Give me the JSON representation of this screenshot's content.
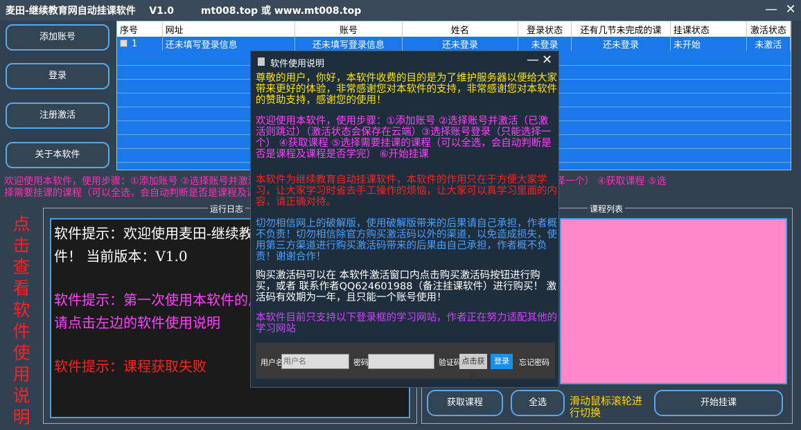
{
  "window": {
    "title": "麦田-继续教育网自动挂课软件    V1.0        mt008.top 或 www.mt008.top",
    "minimize_glyph": "—",
    "close_glyph": "✕"
  },
  "sidebar": {
    "add_account": "添加账号",
    "login": "登录",
    "register": "注册激活",
    "about": "关于本软件"
  },
  "table": {
    "headers": [
      "序号",
      "网址",
      "账号",
      "姓名",
      "登录状态",
      "还有几节未完成的课",
      "挂课状态",
      "激活状态"
    ],
    "rows": [
      [
        "1",
        "还未填写登录信息",
        "还未填写登录信息",
        "还未登录",
        "未登录",
        "还未登录",
        "未开始",
        "未激活"
      ]
    ]
  },
  "usage": {
    "line1": "欢迎使用本软件，使用步骤：①添加账号    ②选择账号并激活（已激活则跳过）（激活状态会保存在云端）  ③选择账号登录（只能选择一个）  ④获取课程  ⑤选",
    "line2": "择需要挂课的课程（可以全选，会自动判断是否是课程及课程是否学完）  ⑥开始挂课"
  },
  "log": {
    "title": "运行日志",
    "lines": [
      {
        "text": "软件提示：欢迎使用麦田-继续教育网自动挂课软",
        "color": "#ffffff"
      },
      {
        "text": "件！  当前版本：V1.0",
        "color": "#ffffff"
      },
      {
        "text": "软件提示：第一次使用本软件的用户",
        "color": "#ff40ff"
      },
      {
        "text": "请点击左边的软件使用说明",
        "color": "#ff40ff"
      },
      {
        "text": "软件提示：课程获取失败",
        "color": "#ff2020"
      }
    ]
  },
  "side_hint": "点击查看软件使用说明",
  "course": {
    "title": "课程列表",
    "fetch_button": "获取课程",
    "select_all_button": "全选",
    "scroll_tip": "滑动鼠标滚轮进行切换",
    "start_button": "开始挂课"
  },
  "dialog": {
    "title": "软件使用说明",
    "minimize_glyph": "—",
    "close_glyph": "✕",
    "paragraphs": [
      {
        "text": "尊敬的用户，你好，本软件收费的目的是为了维护服务器以便给大家带来更好的体验，非常感谢您对本软件的支持，非常感谢您对本软件的赞助支持，感谢您的使用！",
        "color": "#ffe600"
      },
      {
        "text": "欢迎使用本软件，使用步骤：①添加账号  ②选择账号并激活（已激活则跳过）（激活状态会保存在云端）③选择账号登录（只能选择一个）  ④获取课程 ⑤选择需要挂课的课程（可以全选，会自动判断是否是课程及课程是否学完）  ⑥开始挂课",
        "color": "#ff40ff"
      },
      {
        "text": "本软件为继续教育自动挂课软件，本软件的作用只在于方便大家学习，让大家学习时省去手工操作的烦恼，让大家可以真学习里面的内容，请正确对待。",
        "color": "#ff2020"
      },
      {
        "text": "切勿相信网上的破解版，使用破解版带来的后果请自己承担，作者概不负责！切勿相信除官方购买激活码以外的渠道，以免造成损失，使用第三方渠道进行购买激活码带来的后果由自己承担，作者概不负责！谢谢合作！",
        "color": "#4aa0ff"
      },
      {
        "text": "购买激活码可以在 本软件激活窗口内点击购买激活码按钮进行购买，或者 联系作者QQ624601988（备注挂课软件）进行购买！    激活码有效期为一年，且只能一个账号使用！",
        "color": "#ffffff"
      },
      {
        "text": "本软件目前只支持以下登录框的学习网站，作者正在努力适配其他的学习网站",
        "color": "#cc44ff"
      }
    ],
    "login_preview": {
      "username_label": "用户名",
      "username_placeholder": "用户名",
      "password_label": "密码",
      "captcha_label": "验证码",
      "captcha_button": "点击获取",
      "login_button": "登录",
      "forgot": "忘记密码"
    }
  }
}
